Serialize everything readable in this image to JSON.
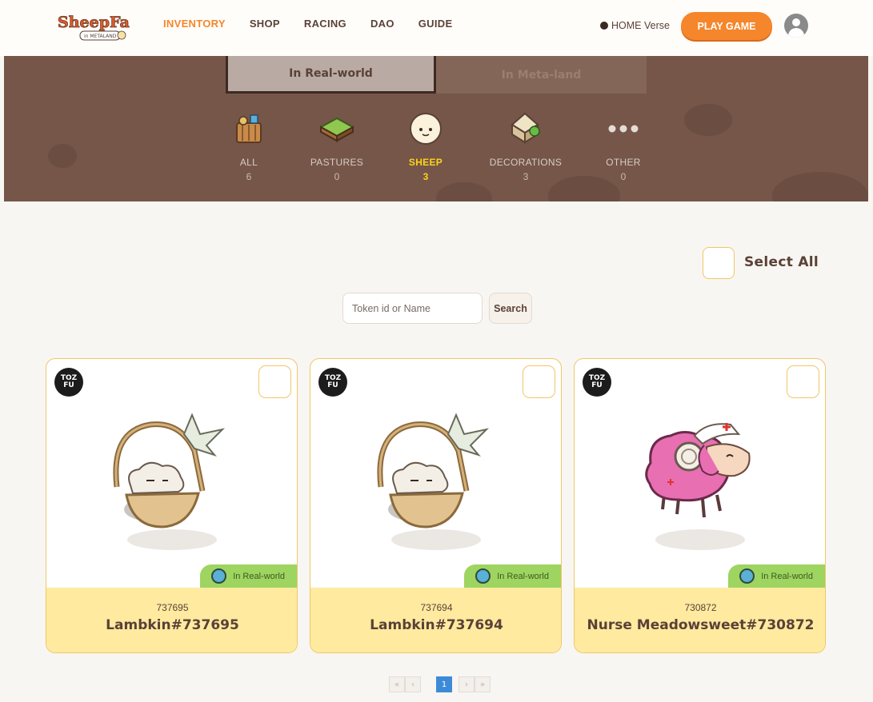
{
  "header": {
    "logo_text": "SheepFarm",
    "logo_sub": "in METALAND",
    "nav": [
      "INVENTORY",
      "SHOP",
      "RACING",
      "DAO",
      "GUIDE"
    ],
    "verse_label": "HOME Verse",
    "play_label": "PLAY GAME",
    "accent_color": "#f5862b"
  },
  "tabs": {
    "real": "In Real-world",
    "meta": "In Meta-land"
  },
  "categories": [
    {
      "label": "ALL",
      "count": "6",
      "icon": "basket-icon"
    },
    {
      "label": "PASTURES",
      "count": "0",
      "icon": "grass-tile-icon"
    },
    {
      "label": "SHEEP",
      "count": "3",
      "icon": "sheep-icon"
    },
    {
      "label": "DECORATIONS",
      "count": "3",
      "icon": "house-icon"
    },
    {
      "label": "OTHER",
      "count": "0",
      "icon": "more-icon"
    }
  ],
  "select_all": "Select All",
  "search": {
    "placeholder": "Token id or Name",
    "button": "Search"
  },
  "cards": [
    {
      "badge": "TOZ FU",
      "location": "In Real-world",
      "token_id": "737695",
      "name": "Lambkin#737695"
    },
    {
      "badge": "TOZ FU",
      "location": "In Real-world",
      "token_id": "737694",
      "name": "Lambkin#737694"
    },
    {
      "badge": "TOZ FU",
      "location": "In Real-world",
      "token_id": "730872",
      "name": "Nurse Meadowsweet#730872"
    }
  ],
  "pagination": {
    "first": "«",
    "prev": "‹",
    "current": "1",
    "next": "›",
    "last": "»"
  }
}
